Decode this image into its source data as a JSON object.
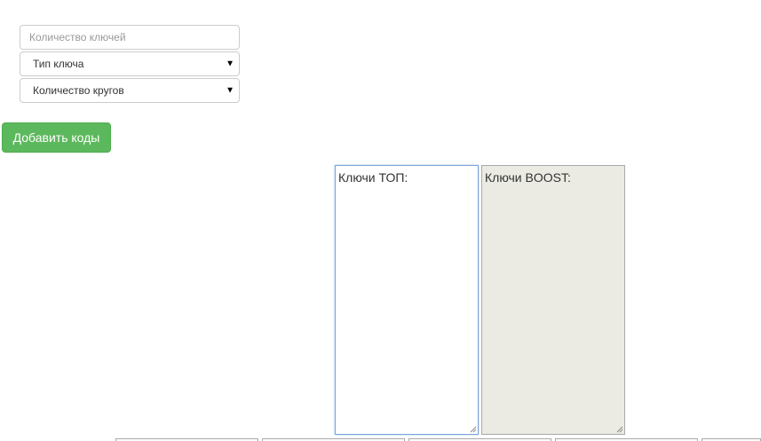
{
  "form": {
    "keys_count_placeholder": "Количество ключей",
    "key_type_selected": "Тип ключа",
    "rounds_count_selected": "Количество кругов",
    "add_codes_label": "Добавить коды"
  },
  "textareas": {
    "top_label": "Ключи ТОП:",
    "boost_label": "Ключи BOOST:"
  },
  "colors": {
    "button_green": "#5cb85c",
    "disabled_textarea_bg": "#ebebe4",
    "focus_border": "#7aa4d8"
  }
}
